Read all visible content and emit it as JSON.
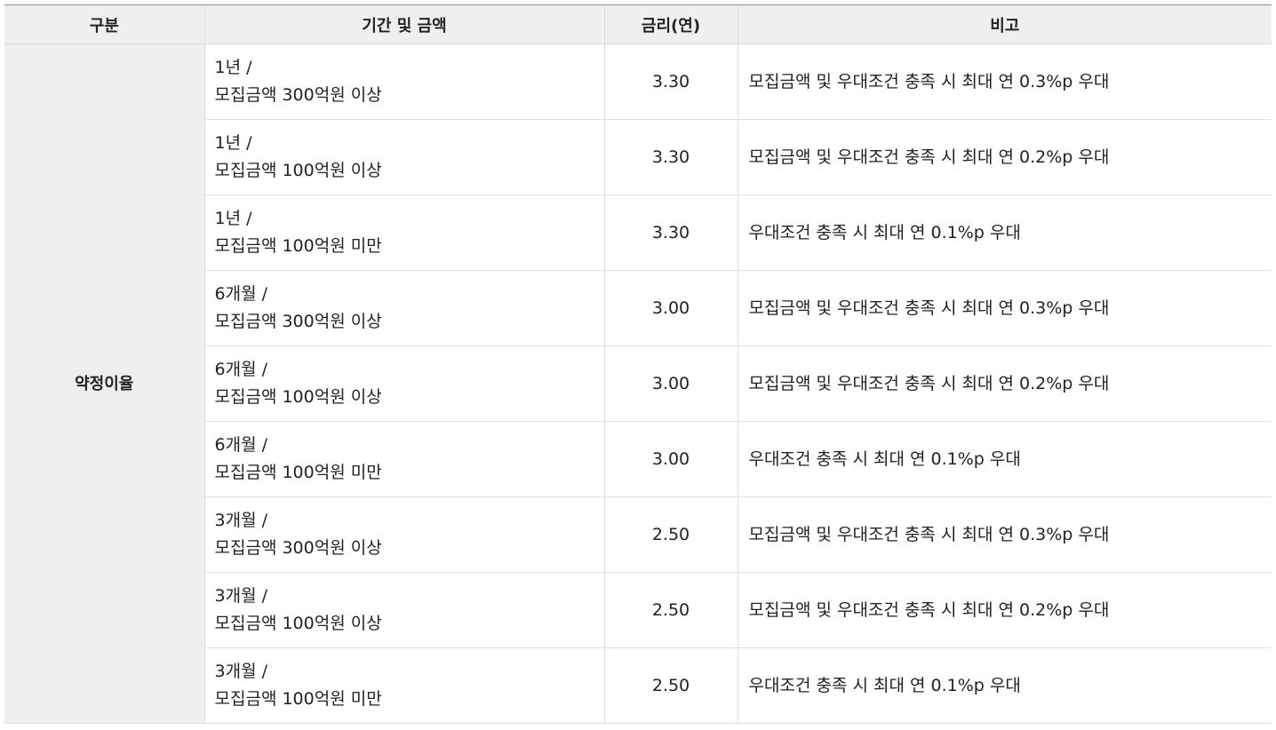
{
  "table": {
    "headers": {
      "category": "구분",
      "period_amount": "기간 및 금액",
      "rate": "금리(연)",
      "note": "비고"
    },
    "category_label": "약정이율",
    "rows": [
      {
        "period": "1년 /",
        "amount": "모집금액 300억원 이상",
        "rate": "3.30",
        "note": "모집금액 및 우대조건 충족 시 최대 연 0.3%p 우대"
      },
      {
        "period": "1년 /",
        "amount": "모집금액 100억원 이상",
        "rate": "3.30",
        "note": "모집금액 및 우대조건 충족 시 최대 연 0.2%p 우대"
      },
      {
        "period": "1년 /",
        "amount": "모집금액 100억원 미만",
        "rate": "3.30",
        "note": "우대조건 충족 시 최대 연 0.1%p 우대"
      },
      {
        "period": "6개월 /",
        "amount": "모집금액 300억원 이상",
        "rate": "3.00",
        "note": "모집금액 및 우대조건 충족 시 최대 연 0.3%p 우대"
      },
      {
        "period": "6개월 /",
        "amount": "모집금액 100억원 이상",
        "rate": "3.00",
        "note": "모집금액 및 우대조건 충족 시 최대 연 0.2%p 우대"
      },
      {
        "period": "6개월 /",
        "amount": "모집금액 100억원 미만",
        "rate": "3.00",
        "note": "우대조건 충족 시 최대 연 0.1%p 우대"
      },
      {
        "period": "3개월 /",
        "amount": "모집금액 300억원 이상",
        "rate": "2.50",
        "note": "모집금액 및 우대조건 충족 시 최대 연 0.3%p 우대"
      },
      {
        "period": "3개월 /",
        "amount": "모집금액 100억원 이상",
        "rate": "2.50",
        "note": "모집금액 및 우대조건 충족 시 최대 연 0.2%p 우대"
      },
      {
        "period": "3개월 /",
        "amount": "모집금액 100억원 미만",
        "rate": "2.50",
        "note": "우대조건 충족 시 최대 연 0.1%p 우대"
      }
    ]
  }
}
